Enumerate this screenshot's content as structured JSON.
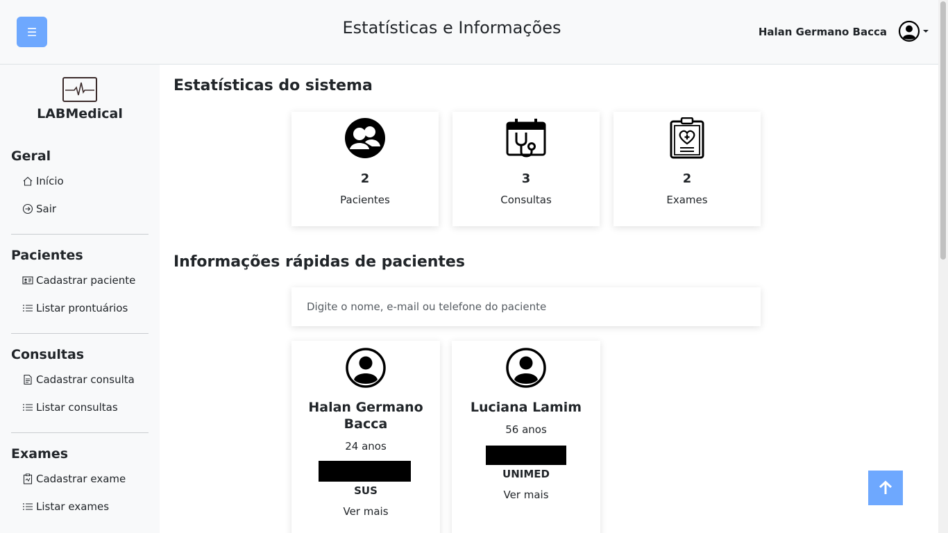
{
  "header": {
    "menu_icon": "☰",
    "title": "Estatísticas e Informações",
    "user_name": "Halan Germano Bacca"
  },
  "sidebar": {
    "brand": "LABMedical",
    "sections": [
      {
        "title": "Geral",
        "items": [
          {
            "label": "Início",
            "icon": "home-icon"
          },
          {
            "label": "Sair",
            "icon": "logout-icon"
          }
        ]
      },
      {
        "title": "Pacientes",
        "items": [
          {
            "label": "Cadastrar paciente",
            "icon": "id-card-icon"
          },
          {
            "label": "Listar prontuários",
            "icon": "list-icon"
          }
        ]
      },
      {
        "title": "Consultas",
        "items": [
          {
            "label": "Cadastrar consulta",
            "icon": "document-icon"
          },
          {
            "label": "Listar consultas",
            "icon": "list-icon"
          }
        ]
      },
      {
        "title": "Exames",
        "items": [
          {
            "label": "Cadastrar exame",
            "icon": "clipboard-icon"
          },
          {
            "label": "Listar exames",
            "icon": "list-icon"
          }
        ]
      }
    ]
  },
  "main": {
    "stats_heading": "Estatísticas do sistema",
    "stats": [
      {
        "value": "2",
        "label": "Pacientes",
        "icon": "patients-icon"
      },
      {
        "value": "3",
        "label": "Consultas",
        "icon": "calendar-stethoscope-icon"
      },
      {
        "value": "2",
        "label": "Exames",
        "icon": "clipboard-heart-icon"
      }
    ],
    "patients_heading": "Informações rápidas de pacientes",
    "search_placeholder": "Digite o nome, e-mail ou telefone do paciente",
    "patients": [
      {
        "name": "Halan Germano Bacca",
        "age": "24 anos",
        "plan": "SUS",
        "more": "Ver mais"
      },
      {
        "name": "Luciana Lamim",
        "age": "56 anos",
        "plan": "UNIMED",
        "more": "Ver mais"
      }
    ]
  },
  "colors": {
    "accent": "#6ea8fe",
    "sidebar_bg": "#f8f9fa"
  }
}
